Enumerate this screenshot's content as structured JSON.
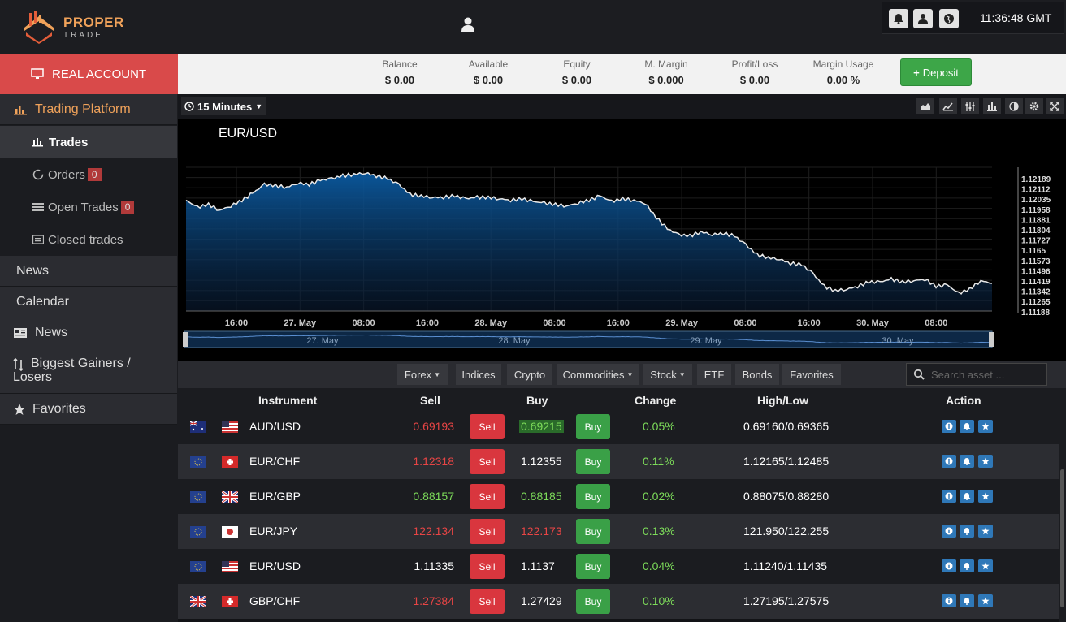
{
  "logo": {
    "name": "PROPER",
    "sub": "TRADE"
  },
  "clock": "11:36:48 GMT",
  "account": {
    "label": "REAL ACCOUNT"
  },
  "stats": [
    {
      "label": "Balance",
      "value": "$ 0.00"
    },
    {
      "label": "Available",
      "value": "$ 0.00"
    },
    {
      "label": "Equity",
      "value": "$ 0.00"
    },
    {
      "label": "M. Margin",
      "value": "$ 0.000"
    },
    {
      "label": "Profit/Loss",
      "value": "$ 0.00"
    },
    {
      "label": "Margin Usage",
      "value": "0.00 %"
    }
  ],
  "deposit_label": "Deposit",
  "sidebar": {
    "trading_platform": "Trading Platform",
    "trades": "Trades",
    "orders": "Orders",
    "orders_count": "0",
    "open_trades": "Open Trades",
    "open_trades_count": "0",
    "closed_trades": "Closed trades",
    "news_main": "News",
    "calendar": "Calendar",
    "news": "News",
    "gainers_line1": "Biggest Gainers /",
    "gainers_line2": "Losers",
    "favorites": "Favorites"
  },
  "chart": {
    "timeframe": "15 Minutes"
  },
  "chart_data": {
    "type": "area",
    "title": "EUR/USD",
    "y_ticks": [
      "1.12189",
      "1.12112",
      "1.12035",
      "1.11958",
      "1.11881",
      "1.11804",
      "1.11727",
      "1.1165",
      "1.11573",
      "1.11496",
      "1.11419",
      "1.11342",
      "1.11265",
      "1.11188"
    ],
    "x_ticks": [
      "16:00",
      "27. May",
      "08:00",
      "16:00",
      "28. May",
      "08:00",
      "16:00",
      "29. May",
      "08:00",
      "16:00",
      "30. May",
      "08:00"
    ],
    "navigator_ticks": [
      "27. May",
      "28. May",
      "29. May",
      "30. May"
    ],
    "ylim": [
      1.11188,
      1.12189
    ],
    "values": [
      1.1196,
      1.1191,
      1.1193,
      1.1189,
      1.1192,
      1.1196,
      1.1201,
      1.1207,
      1.1206,
      1.1205,
      1.1208,
      1.1207,
      1.121,
      1.1211,
      1.1213,
      1.1214,
      1.1215,
      1.1213,
      1.1211,
      1.1207,
      1.12,
      1.1199,
      1.1198,
      1.1198,
      1.1199,
      1.1197,
      1.1198,
      1.1198,
      1.1197,
      1.1196,
      1.1197,
      1.1195,
      1.1194,
      1.1193,
      1.1192,
      1.1194,
      1.1196,
      1.1199,
      1.1195,
      1.1197,
      1.1196,
      1.1194,
      1.1184,
      1.1176,
      1.1172,
      1.1171,
      1.1174,
      1.1172,
      1.1173,
      1.1171,
      1.1165,
      1.1158,
      1.1156,
      1.1155,
      1.1152,
      1.1151,
      1.1145,
      1.1136,
      1.1133,
      1.1134,
      1.1136,
      1.1139,
      1.1139,
      1.1141,
      1.1139,
      1.114,
      1.1141,
      1.1136,
      1.1137,
      1.1131,
      1.1134,
      1.114,
      1.1138
    ]
  },
  "filters": [
    "Forex",
    "Indices",
    "Crypto",
    "Commodities",
    "Stock",
    "ETF",
    "Bonds",
    "Favorites"
  ],
  "search_placeholder": "Search asset ...",
  "table": {
    "headers": {
      "instrument": "Instrument",
      "sell": "Sell",
      "buy": "Buy",
      "change": "Change",
      "highlow": "High/Low",
      "action": "Action"
    },
    "sell_label": "Sell",
    "buy_label": "Buy",
    "rows": [
      {
        "instrument": "AUD/USD",
        "sell": "0.69193",
        "buy": "0.69215",
        "change": "0.05%",
        "highlow": "0.69160/0.69365",
        "sell_color": "#e84545",
        "buy_color": "#7ddc5a",
        "flag1": "AU",
        "flag2": "US"
      },
      {
        "instrument": "EUR/CHF",
        "sell": "1.12318",
        "buy": "1.12355",
        "change": "0.11%",
        "highlow": "1.12165/1.12485",
        "sell_color": "#e84545",
        "buy_color": "#ffffff",
        "flag1": "EU",
        "flag2": "CH"
      },
      {
        "instrument": "EUR/GBP",
        "sell": "0.88157",
        "buy": "0.88185",
        "change": "0.02%",
        "highlow": "0.88075/0.88280",
        "sell_color": "#7ddc5a",
        "buy_color": "#7ddc5a",
        "flag1": "EU",
        "flag2": "GB"
      },
      {
        "instrument": "EUR/JPY",
        "sell": "122.134",
        "buy": "122.173",
        "change": "0.13%",
        "highlow": "121.950/122.255",
        "sell_color": "#e84545",
        "buy_color": "#e84545",
        "flag1": "EU",
        "flag2": "JP"
      },
      {
        "instrument": "EUR/USD",
        "sell": "1.11335",
        "buy": "1.1137",
        "change": "0.04%",
        "highlow": "1.11240/1.11435",
        "sell_color": "#ffffff",
        "buy_color": "#ffffff",
        "flag1": "EU",
        "flag2": "US"
      },
      {
        "instrument": "GBP/CHF",
        "sell": "1.27384",
        "buy": "1.27429",
        "change": "0.10%",
        "highlow": "1.27195/1.27575",
        "sell_color": "#e84545",
        "buy_color": "#ffffff",
        "flag1": "GB",
        "flag2": "CH"
      }
    ]
  },
  "colors": {
    "accent": "#d94a4a",
    "positive": "#7ddc5a",
    "negative": "#e84545",
    "highlight": "#f0a25a"
  }
}
